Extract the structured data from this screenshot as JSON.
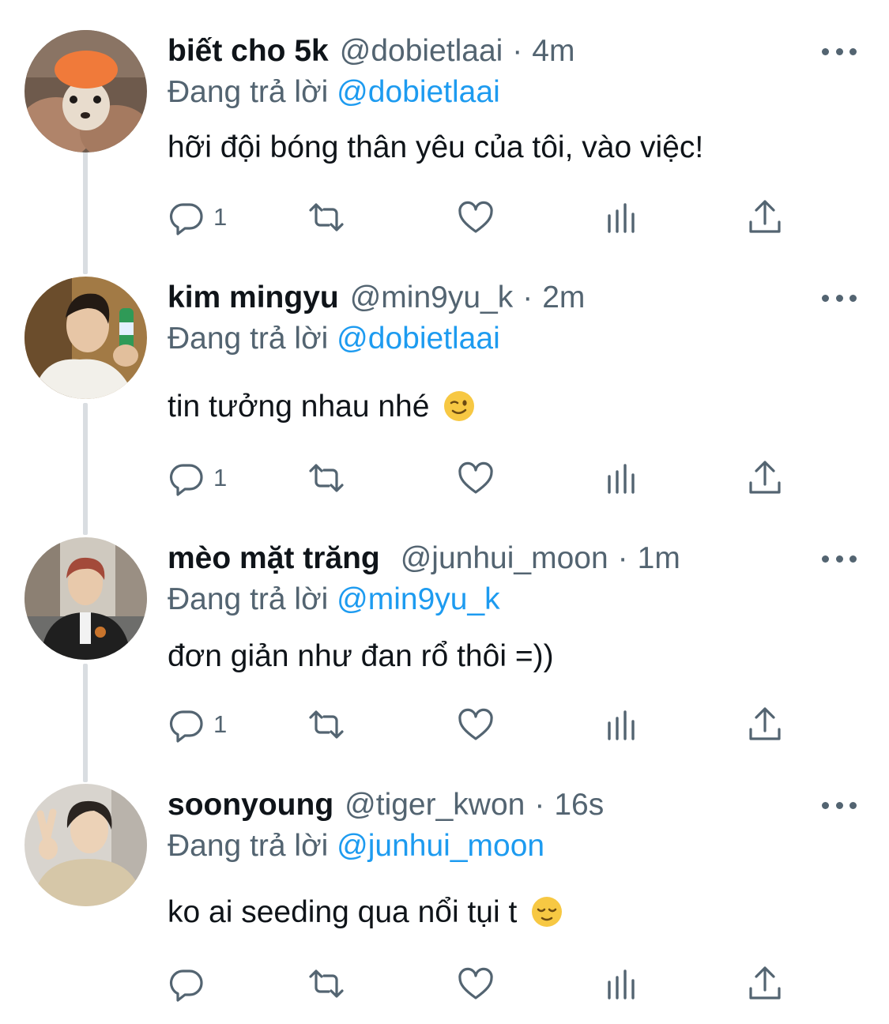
{
  "reply_prefix": "Đang trả lời",
  "tweets": [
    {
      "name": "biết cho 5k",
      "handle": "@dobietlaai",
      "time": "4m",
      "replying_to": "@dobietlaai",
      "text": "hỡi đội bóng thân yêu của tôi, vào việc!",
      "emoji": "",
      "reply_count": "1",
      "avatar_icon": "avatar-chihuahua-photo"
    },
    {
      "name": "kim mingyu",
      "handle": "@min9yu_k",
      "time": "2m",
      "replying_to": "@dobietlaai",
      "text": "tin tưởng nhau nhé",
      "emoji": "winking-face-emoji",
      "reply_count": "1",
      "avatar_icon": "avatar-man-with-bottle-photo"
    },
    {
      "name": "mèo mặt trăng",
      "handle": "@junhui_moon",
      "time": "1m",
      "replying_to": "@min9yu_k",
      "text": "đơn giản như đan rổ thôi =))",
      "emoji": "",
      "reply_count": "1",
      "avatar_icon": "avatar-man-city-street-photo"
    },
    {
      "name": "soonyoung",
      "handle": "@tiger_kwon",
      "time": "16s",
      "replying_to": "@junhui_moon",
      "text": "ko ai seeding qua nổi tụi t",
      "emoji": "relieved-face-emoji",
      "reply_count": "",
      "avatar_icon": "avatar-man-peace-sign-photo"
    }
  ],
  "icons": {
    "reply": "reply-bubble-icon",
    "retweet": "retweet-icon",
    "like": "heart-icon",
    "analytics": "bar-chart-icon",
    "share": "share-upload-icon",
    "more": "more-dots-icon"
  },
  "colors": {
    "name": "#0f1419",
    "muted": "#536471",
    "link": "#1d9bf0",
    "thread_line": "#d9dde1"
  }
}
